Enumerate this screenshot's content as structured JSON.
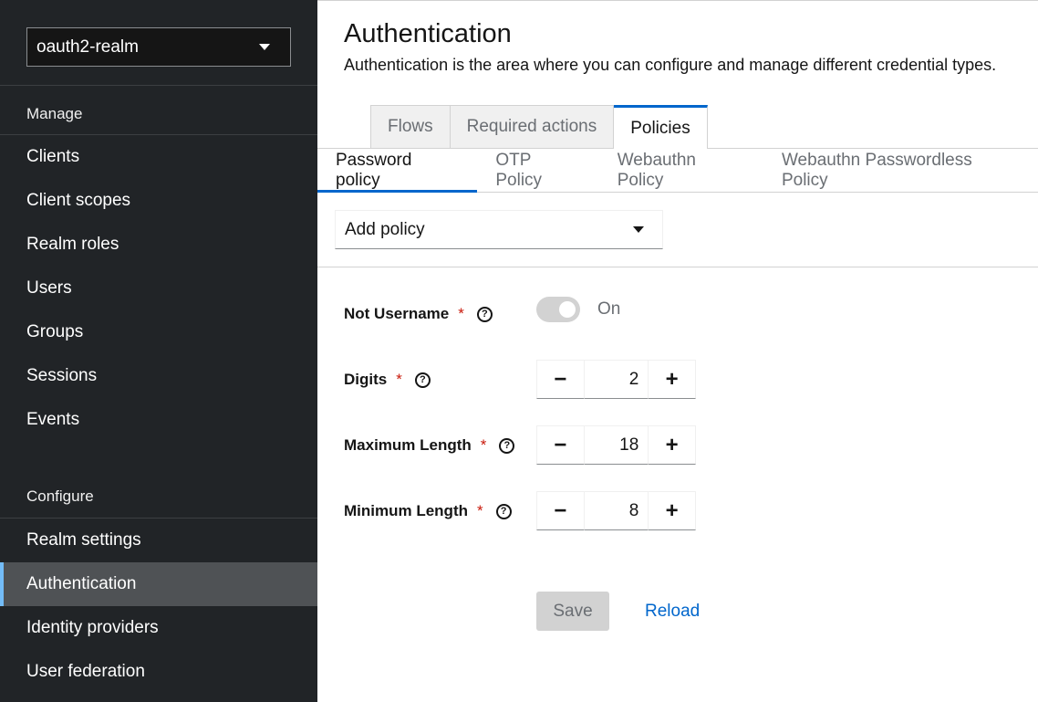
{
  "sidebar": {
    "realm": "oauth2-realm",
    "manage_title": "Manage",
    "manage_items": [
      "Clients",
      "Client scopes",
      "Realm roles",
      "Users",
      "Groups",
      "Sessions",
      "Events"
    ],
    "configure_title": "Configure",
    "configure_items": [
      "Realm settings",
      "Authentication",
      "Identity providers",
      "User federation"
    ],
    "active_item": "Authentication"
  },
  "page": {
    "title": "Authentication",
    "description": "Authentication is the area where you can configure and manage different credential types."
  },
  "tabs": [
    "Flows",
    "Required actions",
    "Policies"
  ],
  "active_tab": "Policies",
  "subtabs": [
    "Password policy",
    "OTP Policy",
    "Webauthn Policy",
    "Webauthn Passwordless Policy"
  ],
  "active_subtab": "Password policy",
  "add_policy": {
    "label": "Add policy"
  },
  "form": {
    "required_mark": "*",
    "help_glyph": "?",
    "not_username": {
      "label": "Not Username",
      "state": "On"
    },
    "digits": {
      "label": "Digits",
      "value": "2"
    },
    "max_length": {
      "label": "Maximum Length",
      "value": "18"
    },
    "min_length": {
      "label": "Minimum Length",
      "value": "8"
    },
    "minus": "−",
    "plus": "+"
  },
  "actions": {
    "save": "Save",
    "reload": "Reload"
  },
  "colors": {
    "sidebar_bg": "#212427",
    "active_nav": "#4f5255",
    "accent": "#0066cc",
    "active_indicator": "#73bcf7",
    "required": "#c9190b"
  }
}
